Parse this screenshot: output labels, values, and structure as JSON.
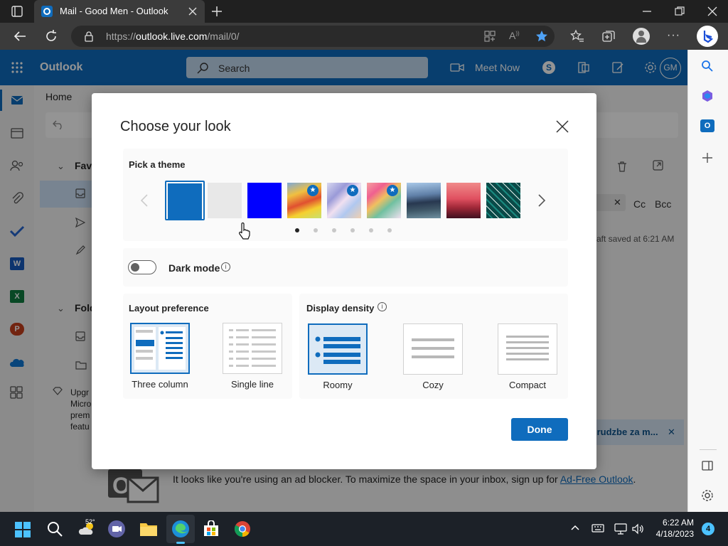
{
  "browser": {
    "tab_title": "Mail - Good Men - Outlook",
    "url_prefix": "https://",
    "url_host": "outlook.live.com",
    "url_path": "/mail/0/"
  },
  "outlook": {
    "app_name": "Outlook",
    "search_placeholder": "Search",
    "meet_now": "Meet Now",
    "avatar_initials": "GM",
    "ribbon_home": "Home",
    "nav_favorites": "Favo",
    "nav_folders": "Fold",
    "upgrade_text": [
      "Upgr",
      "Micro",
      "prem",
      "featu"
    ],
    "compose_cc": "Cc",
    "compose_bcc": "Bcc",
    "draft_saved": "aft saved at 6:21 AM",
    "notice_text": "ırudzbe za m...",
    "adblock_text": "It looks like you're using an ad blocker. To maximize the space in your inbox, sign up for ",
    "adblock_link": "Ad-Free Outlook",
    "adblock_period": "."
  },
  "dialog": {
    "title": "Choose your look",
    "pick_theme": "Pick a theme",
    "dark_mode": "Dark mode",
    "dark_mode_on": false,
    "layout_preference": "Layout preference",
    "display_density": "Display density",
    "layouts": [
      {
        "label": "Three column",
        "selected": true
      },
      {
        "label": "Single line",
        "selected": false
      }
    ],
    "densities": [
      {
        "label": "Roomy",
        "selected": true
      },
      {
        "label": "Cozy",
        "selected": false
      },
      {
        "label": "Compact",
        "selected": false
      }
    ],
    "done": "Done",
    "theme_swatches": [
      {
        "name": "blue",
        "color": "#0f6cbd",
        "selected": true
      },
      {
        "name": "light-gray",
        "color": "#e8e8e8"
      },
      {
        "name": "bright-blue",
        "color": "#0000ff"
      },
      {
        "name": "rainbow",
        "premium": true
      },
      {
        "name": "abstract",
        "premium": true
      },
      {
        "name": "palette",
        "premium": true
      },
      {
        "name": "ocean"
      },
      {
        "name": "sunset"
      },
      {
        "name": "circuit"
      }
    ],
    "page_dots": 6,
    "active_dot": 0
  },
  "taskbar": {
    "weather_temp": "52°",
    "time": "6:22 AM",
    "date": "4/18/2023",
    "notification_count": "4"
  },
  "colors": {
    "accent": "#0f6cbd",
    "done_button": "#0f6cbd"
  }
}
